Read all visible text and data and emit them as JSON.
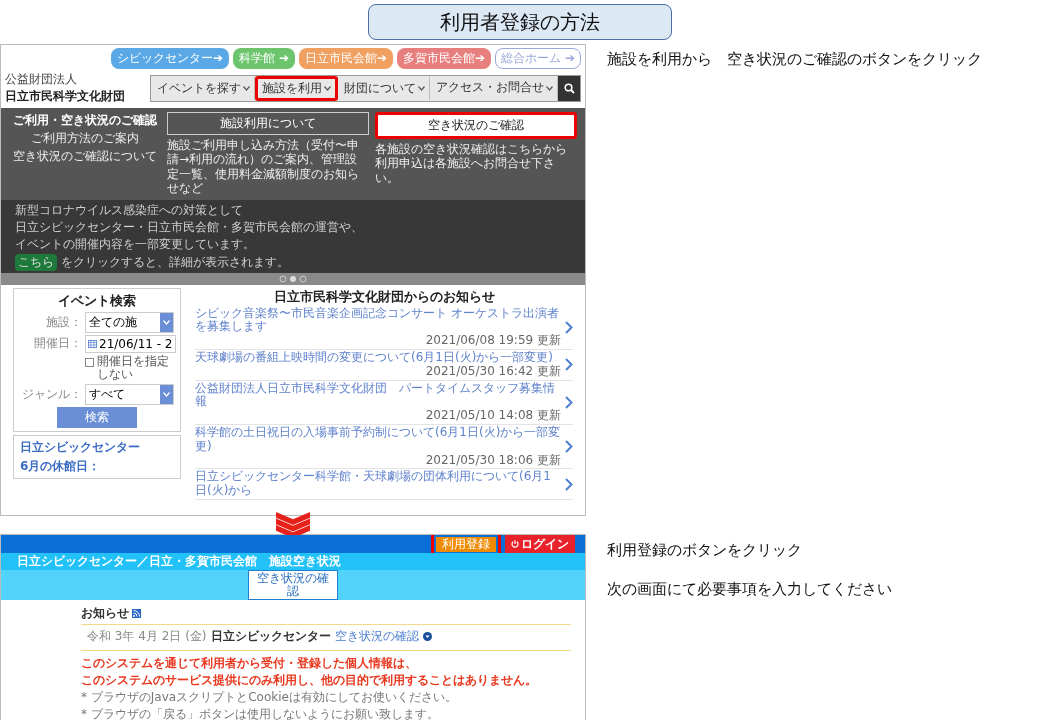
{
  "slide_title": "利用者登録の方法",
  "instructions": [
    {
      "text": "施設を利用から　空き状況のご確認のボタンをクリック"
    },
    {
      "text": "利用登録のボタンをクリック"
    },
    {
      "text": "次の画面にて必要事項を入力してください"
    }
  ],
  "foundation_site": {
    "logo": {
      "caption": "公益財団法人",
      "name": "日立市民科学文化財団"
    },
    "site_links": [
      {
        "label": "シビックセンター➔",
        "kind": "filled",
        "color": "#5aa9e6"
      },
      {
        "label": "科学館 ➔",
        "kind": "filled",
        "color": "#6cc46c"
      },
      {
        "label": "日立市民会館➔",
        "kind": "filled",
        "color": "#f0a060"
      },
      {
        "label": "多賀市民会館➔",
        "kind": "filled",
        "color": "#e87f7f"
      },
      {
        "label": "総合ホーム ➔",
        "kind": "outline",
        "color": "#9aa8d8"
      }
    ],
    "nav": [
      {
        "label": "イベントを探す",
        "highlighted": false
      },
      {
        "label": "施設を利用",
        "highlighted": true
      },
      {
        "label": "財団について",
        "highlighted": false
      },
      {
        "label": "アクセス・お問合せ",
        "highlighted": false
      }
    ],
    "banner": {
      "lines": [
        "新型コロナウイルス感染症への対策として",
        "日立シビックセンター・日立市民会館・多賀市民会館の運営や、",
        "イベントの開催内容を一部変更しています。"
      ],
      "link": "こちら",
      "link_suffix": "をクリックすると、詳細が表示されます。"
    },
    "dropdown": {
      "heading": "ご利用・空き状況のご確認",
      "sub_lines": [
        "ご利用方法のご案内",
        "空き状況のご確認について"
      ],
      "panels": [
        {
          "button": "施設利用について",
          "kind": "outline",
          "highlighted": false,
          "description": "施設ご利用申し込み方法（受付〜申請→利用の流れ）のご案内、管理設定一覧、使用料金減額制度のお知らせなど"
        },
        {
          "button": "空き状況のご確認",
          "kind": "filled",
          "highlighted": true,
          "description": "各施設の空き状況確認はこちらから利用申込は各施設へお問合せ下さい。"
        }
      ]
    },
    "event_search": {
      "title": "イベント検索",
      "fields": [
        {
          "label": "施設：",
          "kind": "select",
          "value": "全ての施"
        },
        {
          "label": "開催日：",
          "kind": "date",
          "value": "21/06/11 - 2",
          "checkbox": {
            "label": "開催日を指定しない",
            "checked": false
          }
        },
        {
          "label": "ジャンル：",
          "kind": "select",
          "value": "すべて"
        }
      ],
      "button": "検索"
    },
    "holiday_card": {
      "title": "日立シビックセンター",
      "subtitle": "6月の休館日："
    },
    "news": {
      "title": "日立市民科学文化財団からのお知らせ",
      "items": [
        {
          "title": "シビック音楽祭〜市民音楽企画記念コンサート オーケストラ出演者を募集します",
          "date": "2021/06/08 19:59 更新"
        },
        {
          "title": "天球劇場の番組上映時間の変更について(6月1日(火)から一部変更)",
          "date": "2021/05/30 16:42 更新"
        },
        {
          "title": "公益財団法人日立市民科学文化財団　パートタイムスタッフ募集情報",
          "date": "2021/05/10 14:08 更新"
        },
        {
          "title": "科学館の土日祝日の入場事前予約制について(6月1日(火)から一部変更)",
          "date": "2021/05/30 18:06 更新"
        },
        {
          "title": "日立シビックセンター科学館・天球劇場の団体利用について(6月1日(火)から"
        }
      ]
    }
  },
  "reservation_site": {
    "header_buttons": [
      {
        "label": "利用登録",
        "kind": "register",
        "highlighted": true
      },
      {
        "label": "ログイン",
        "kind": "login",
        "highlighted": false
      }
    ],
    "title": "日立シビックセンター／日立・多賀市民会館　施設空き状況",
    "main_button": "空き状況の確認",
    "notice": {
      "heading": "お知らせ",
      "date": "令和 3年 4月 2日 (金)",
      "facility": "日立シビックセンター",
      "link": "空き状況の確認"
    },
    "warnings": [
      "このシステムを通じて利用者から受付・登録した個人情報は、",
      "このシステムのサービス提供にのみ利用し、他の目的で利用することはありません。"
    ],
    "notes": [
      "* ブラウザのJavaスクリプトとCookieは有効にしてお使いください。",
      "* ブラウザの「戻る」ボタンは使用しないようにお願い致します。"
    ]
  }
}
